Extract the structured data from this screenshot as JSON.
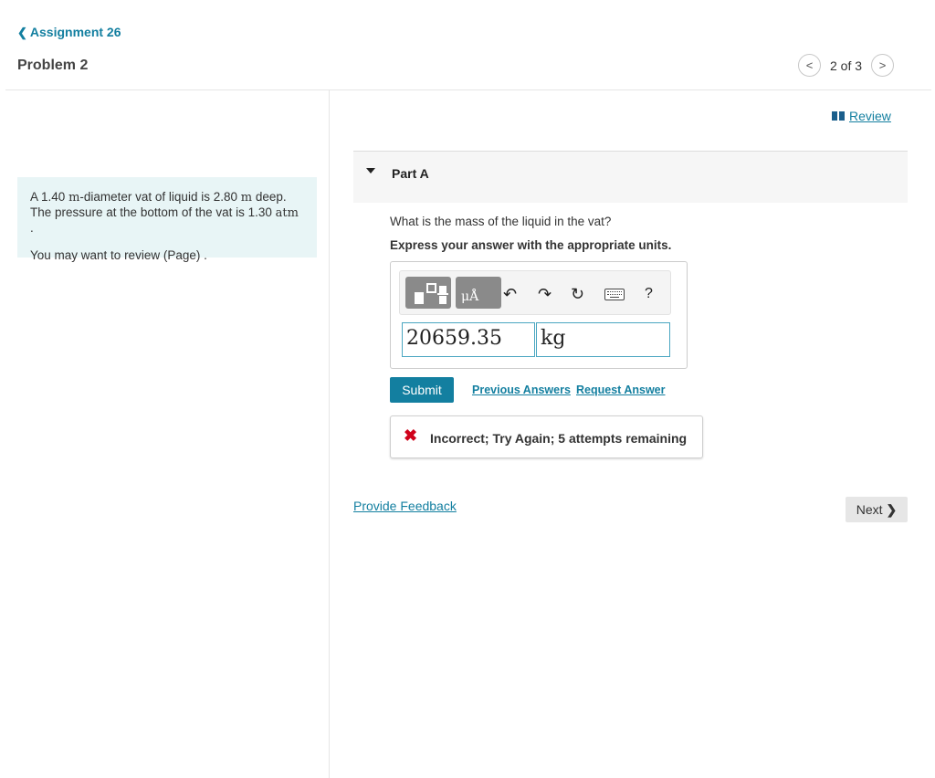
{
  "header": {
    "back_label": "Assignment 26",
    "back_icon": "chevron-left-icon",
    "problem_title": "Problem 2",
    "pager_text": "2 of 3"
  },
  "problem": {
    "line1_a": "A 1.40",
    "line1_unit1": "m",
    "line1_b": "-diameter vat of liquid is 2.80",
    "line1_unit2": "m",
    "line1_c": "deep.",
    "line2_a": "The pressure at the bottom of the vat is 1.30",
    "line2_unit": "atm",
    "line2_b": ".",
    "review_note": "You may want to review (Page) ."
  },
  "review_label": "Review",
  "part": {
    "title": "Part A",
    "question": "What is the mass of the liquid in the vat?",
    "instruction": "Express your answer with the appropriate units."
  },
  "toolbar": {
    "units_label": "μÅ",
    "help_label": "?"
  },
  "answer": {
    "value": "20659.35",
    "unit": "kg"
  },
  "actions": {
    "submit_label": "Submit",
    "previous_answers_label": "Previous Answers",
    "request_answer_label": "Request Answer"
  },
  "feedback": {
    "message": "Incorrect; Try Again; 5 attempts remaining",
    "status_color": "#d0021b"
  },
  "footer": {
    "provide_feedback_label": "Provide Feedback",
    "next_label": "Next"
  },
  "colors": {
    "accent": "#137fa0",
    "problem_bg": "#e8f5f6"
  }
}
